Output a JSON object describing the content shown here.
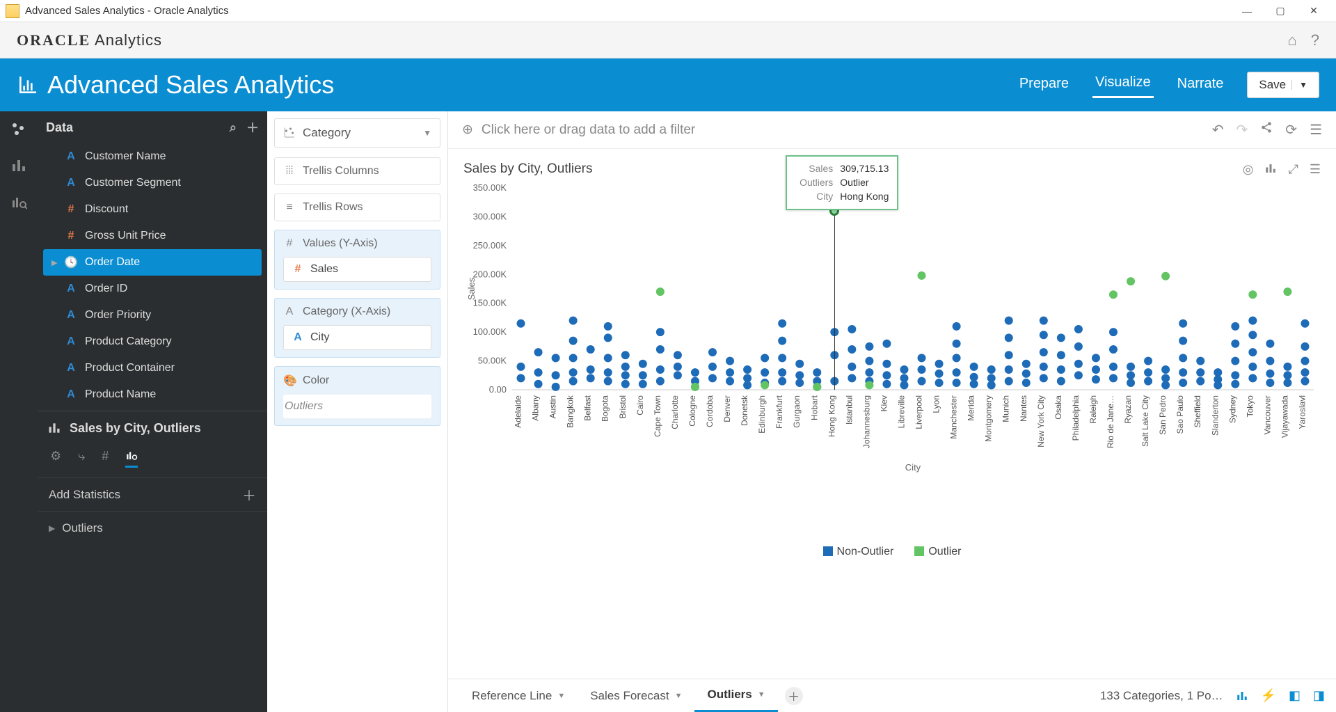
{
  "window": {
    "title": "Advanced Sales Analytics - Oracle Analytics"
  },
  "brand": {
    "logo": "ORACLE",
    "suffix": " Analytics"
  },
  "header": {
    "title": "Advanced Sales Analytics",
    "tabs": {
      "prepare": "Prepare",
      "visualize": "Visualize",
      "narrate": "Narrate"
    },
    "save": "Save"
  },
  "sidebar": {
    "title": "Data",
    "fields": [
      {
        "label": "Customer Name",
        "type": "A"
      },
      {
        "label": "Customer Segment",
        "type": "A"
      },
      {
        "label": "Discount",
        "type": "#"
      },
      {
        "label": "Gross Unit Price",
        "type": "#"
      },
      {
        "label": "Order Date",
        "type": "O",
        "selected": true
      },
      {
        "label": "Order ID",
        "type": "A"
      },
      {
        "label": "Order Priority",
        "type": "A"
      },
      {
        "label": "Product Category",
        "type": "A"
      },
      {
        "label": "Product Container",
        "type": "A"
      },
      {
        "label": "Product Name",
        "type": "A"
      }
    ],
    "analysisTitle": "Sales by City, Outliers",
    "addStats": "Add Statistics",
    "outliers": "Outliers"
  },
  "grammar": {
    "vizType": "Category",
    "shelves": [
      {
        "label": "Trellis Columns",
        "filled": false
      },
      {
        "label": "Trellis Rows",
        "filled": false
      },
      {
        "label": "Values (Y-Axis)",
        "filled": true,
        "pill": "Sales",
        "ptype": "#"
      },
      {
        "label": "Category (X-Axis)",
        "filled": true,
        "pill": "City",
        "ptype": "A"
      },
      {
        "label": "Color",
        "filled": true,
        "pill": "Outliers",
        "ptype": "ital"
      }
    ]
  },
  "filterbar": {
    "hint": "Click here or drag data to add a filter"
  },
  "viz": {
    "title": "Sales by City, Outliers",
    "ylabel": "Sales",
    "xlabel": "City",
    "legend": {
      "non": "Non-Outlier",
      "out": "Outlier"
    },
    "tooltip": {
      "sales_k": "Sales",
      "sales_v": "309,715.13",
      "out_k": "Outliers",
      "out_v": "Outlier",
      "city_k": "City",
      "city_v": "Hong Kong"
    }
  },
  "bottombar": {
    "tabs": [
      {
        "label": "Reference Line"
      },
      {
        "label": "Sales Forecast"
      },
      {
        "label": "Outliers",
        "active": true
      }
    ],
    "status": "133 Categories, 1 Po…"
  },
  "chart_data": {
    "type": "scatter",
    "title": "Sales by City, Outliers",
    "xlabel": "City",
    "ylabel": "Sales",
    "ylim": [
      0,
      350000
    ],
    "yticks": [
      "0.00",
      "50.00K",
      "100.00K",
      "150.00K",
      "200.00K",
      "250.00K",
      "300.00K",
      "350.00K"
    ],
    "legend": [
      "Non-Outlier",
      "Outlier"
    ],
    "colors": {
      "Non-Outlier": "#1e6bb8",
      "Outlier": "#62c462"
    },
    "categories": [
      "Adelaide",
      "Albany",
      "Austin",
      "Bangkok",
      "Belfast",
      "Bogota",
      "Bristol",
      "Cairo",
      "Cape Town",
      "Charlotte",
      "Cologne",
      "Cordoba",
      "Denver",
      "Donetsk",
      "Edinburgh",
      "Frankfurt",
      "Gurgaon",
      "Hobart",
      "Hong Kong",
      "Istanbul",
      "Johannesburg",
      "Kiev",
      "Libreville",
      "Liverpool",
      "Lyon",
      "Manchester",
      "Merida",
      "Montgomery",
      "Munich",
      "Nantes",
      "New York City",
      "Osaka",
      "Philadelphia",
      "Raleigh",
      "Rio de Jane…",
      "Ryazan",
      "Salt Lake City",
      "San Pedro",
      "Sao Paulo",
      "Sheffield",
      "Slanderton",
      "Sydney",
      "Tokyo",
      "Vancouver",
      "Vijayawada",
      "Yaroslavl"
    ],
    "series": [
      {
        "name": "Non-Outlier",
        "points": [
          [
            "Adelaide",
            115000
          ],
          [
            "Adelaide",
            40000
          ],
          [
            "Adelaide",
            20000
          ],
          [
            "Albany",
            65000
          ],
          [
            "Albany",
            30000
          ],
          [
            "Albany",
            10000
          ],
          [
            "Austin",
            55000
          ],
          [
            "Austin",
            25000
          ],
          [
            "Austin",
            5000
          ],
          [
            "Bangkok",
            120000
          ],
          [
            "Bangkok",
            85000
          ],
          [
            "Bangkok",
            55000
          ],
          [
            "Bangkok",
            30000
          ],
          [
            "Bangkok",
            15000
          ],
          [
            "Belfast",
            70000
          ],
          [
            "Belfast",
            35000
          ],
          [
            "Belfast",
            20000
          ],
          [
            "Bogota",
            110000
          ],
          [
            "Bogota",
            90000
          ],
          [
            "Bogota",
            55000
          ],
          [
            "Bogota",
            30000
          ],
          [
            "Bogota",
            15000
          ],
          [
            "Bristol",
            60000
          ],
          [
            "Bristol",
            40000
          ],
          [
            "Bristol",
            25000
          ],
          [
            "Bristol",
            10000
          ],
          [
            "Cairo",
            45000
          ],
          [
            "Cairo",
            25000
          ],
          [
            "Cairo",
            10000
          ],
          [
            "Cape Town",
            100000
          ],
          [
            "Cape Town",
            70000
          ],
          [
            "Cape Town",
            35000
          ],
          [
            "Cape Town",
            15000
          ],
          [
            "Charlotte",
            60000
          ],
          [
            "Charlotte",
            40000
          ],
          [
            "Charlotte",
            25000
          ],
          [
            "Cologne",
            30000
          ],
          [
            "Cologne",
            15000
          ],
          [
            "Cologne",
            5000
          ],
          [
            "Cordoba",
            65000
          ],
          [
            "Cordoba",
            40000
          ],
          [
            "Cordoba",
            20000
          ],
          [
            "Denver",
            50000
          ],
          [
            "Denver",
            30000
          ],
          [
            "Denver",
            15000
          ],
          [
            "Donetsk",
            35000
          ],
          [
            "Donetsk",
            20000
          ],
          [
            "Donetsk",
            8000
          ],
          [
            "Edinburgh",
            55000
          ],
          [
            "Edinburgh",
            30000
          ],
          [
            "Edinburgh",
            12000
          ],
          [
            "Frankfurt",
            115000
          ],
          [
            "Frankfurt",
            85000
          ],
          [
            "Frankfurt",
            55000
          ],
          [
            "Frankfurt",
            30000
          ],
          [
            "Frankfurt",
            15000
          ],
          [
            "Gurgaon",
            45000
          ],
          [
            "Gurgaon",
            25000
          ],
          [
            "Gurgaon",
            12000
          ],
          [
            "Hobart",
            30000
          ],
          [
            "Hobart",
            15000
          ],
          [
            "Hobart",
            5000
          ],
          [
            "Hong Kong",
            100000
          ],
          [
            "Hong Kong",
            60000
          ],
          [
            "Hong Kong",
            15000
          ],
          [
            "Istanbul",
            105000
          ],
          [
            "Istanbul",
            70000
          ],
          [
            "Istanbul",
            40000
          ],
          [
            "Istanbul",
            20000
          ],
          [
            "Johannesburg",
            75000
          ],
          [
            "Johannesburg",
            50000
          ],
          [
            "Johannesburg",
            30000
          ],
          [
            "Johannesburg",
            15000
          ],
          [
            "Kiev",
            80000
          ],
          [
            "Kiev",
            45000
          ],
          [
            "Kiev",
            25000
          ],
          [
            "Kiev",
            10000
          ],
          [
            "Libreville",
            35000
          ],
          [
            "Libreville",
            20000
          ],
          [
            "Libreville",
            8000
          ],
          [
            "Liverpool",
            55000
          ],
          [
            "Liverpool",
            35000
          ],
          [
            "Liverpool",
            15000
          ],
          [
            "Lyon",
            45000
          ],
          [
            "Lyon",
            28000
          ],
          [
            "Lyon",
            12000
          ],
          [
            "Manchester",
            110000
          ],
          [
            "Manchester",
            80000
          ],
          [
            "Manchester",
            55000
          ],
          [
            "Manchester",
            30000
          ],
          [
            "Manchester",
            12000
          ],
          [
            "Merida",
            40000
          ],
          [
            "Merida",
            22000
          ],
          [
            "Merida",
            10000
          ],
          [
            "Montgomery",
            35000
          ],
          [
            "Montgomery",
            20000
          ],
          [
            "Montgomery",
            8000
          ],
          [
            "Munich",
            120000
          ],
          [
            "Munich",
            90000
          ],
          [
            "Munich",
            60000
          ],
          [
            "Munich",
            35000
          ],
          [
            "Munich",
            15000
          ],
          [
            "Nantes",
            45000
          ],
          [
            "Nantes",
            28000
          ],
          [
            "Nantes",
            12000
          ],
          [
            "New York City",
            120000
          ],
          [
            "New York City",
            95000
          ],
          [
            "New York City",
            65000
          ],
          [
            "New York City",
            40000
          ],
          [
            "New York City",
            20000
          ],
          [
            "Osaka",
            90000
          ],
          [
            "Osaka",
            60000
          ],
          [
            "Osaka",
            35000
          ],
          [
            "Osaka",
            15000
          ],
          [
            "Philadelphia",
            105000
          ],
          [
            "Philadelphia",
            75000
          ],
          [
            "Philadelphia",
            45000
          ],
          [
            "Philadelphia",
            25000
          ],
          [
            "Raleigh",
            55000
          ],
          [
            "Raleigh",
            35000
          ],
          [
            "Raleigh",
            18000
          ],
          [
            "Rio de Jane…",
            100000
          ],
          [
            "Rio de Jane…",
            70000
          ],
          [
            "Rio de Jane…",
            40000
          ],
          [
            "Rio de Jane…",
            20000
          ],
          [
            "Ryazan",
            40000
          ],
          [
            "Ryazan",
            25000
          ],
          [
            "Ryazan",
            12000
          ],
          [
            "Salt Lake City",
            50000
          ],
          [
            "Salt Lake City",
            30000
          ],
          [
            "Salt Lake City",
            15000
          ],
          [
            "San Pedro",
            35000
          ],
          [
            "San Pedro",
            20000
          ],
          [
            "San Pedro",
            8000
          ],
          [
            "Sao Paulo",
            115000
          ],
          [
            "Sao Paulo",
            85000
          ],
          [
            "Sao Paulo",
            55000
          ],
          [
            "Sao Paulo",
            30000
          ],
          [
            "Sao Paulo",
            12000
          ],
          [
            "Sheffield",
            50000
          ],
          [
            "Sheffield",
            30000
          ],
          [
            "Sheffield",
            15000
          ],
          [
            "Slanderton",
            30000
          ],
          [
            "Slanderton",
            18000
          ],
          [
            "Slanderton",
            8000
          ],
          [
            "Sydney",
            110000
          ],
          [
            "Sydney",
            80000
          ],
          [
            "Sydney",
            50000
          ],
          [
            "Sydney",
            25000
          ],
          [
            "Sydney",
            10000
          ],
          [
            "Tokyo",
            120000
          ],
          [
            "Tokyo",
            95000
          ],
          [
            "Tokyo",
            65000
          ],
          [
            "Tokyo",
            40000
          ],
          [
            "Tokyo",
            20000
          ],
          [
            "Vancouver",
            80000
          ],
          [
            "Vancouver",
            50000
          ],
          [
            "Vancouver",
            28000
          ],
          [
            "Vancouver",
            12000
          ],
          [
            "Vijayawada",
            40000
          ],
          [
            "Vijayawada",
            25000
          ],
          [
            "Vijayawada",
            12000
          ],
          [
            "Yaroslavl",
            75000
          ],
          [
            "Yaroslavl",
            115000
          ],
          [
            "Yaroslavl",
            50000
          ],
          [
            "Yaroslavl",
            30000
          ],
          [
            "Yaroslavl",
            15000
          ]
        ]
      },
      {
        "name": "Outlier",
        "points": [
          [
            "Cape Town",
            170000
          ],
          [
            "Cologne",
            5000
          ],
          [
            "Edinburgh",
            8000
          ],
          [
            "Hobart",
            5000
          ],
          [
            "Hong Kong",
            309715
          ],
          [
            "Johannesburg",
            8000
          ],
          [
            "Liverpool",
            198000
          ],
          [
            "Rio de Jane…",
            165000
          ],
          [
            "Ryazan",
            188000
          ],
          [
            "San Pedro",
            197000
          ],
          [
            "Tokyo",
            165000
          ],
          [
            "Vijayawada",
            170000
          ]
        ]
      }
    ]
  }
}
